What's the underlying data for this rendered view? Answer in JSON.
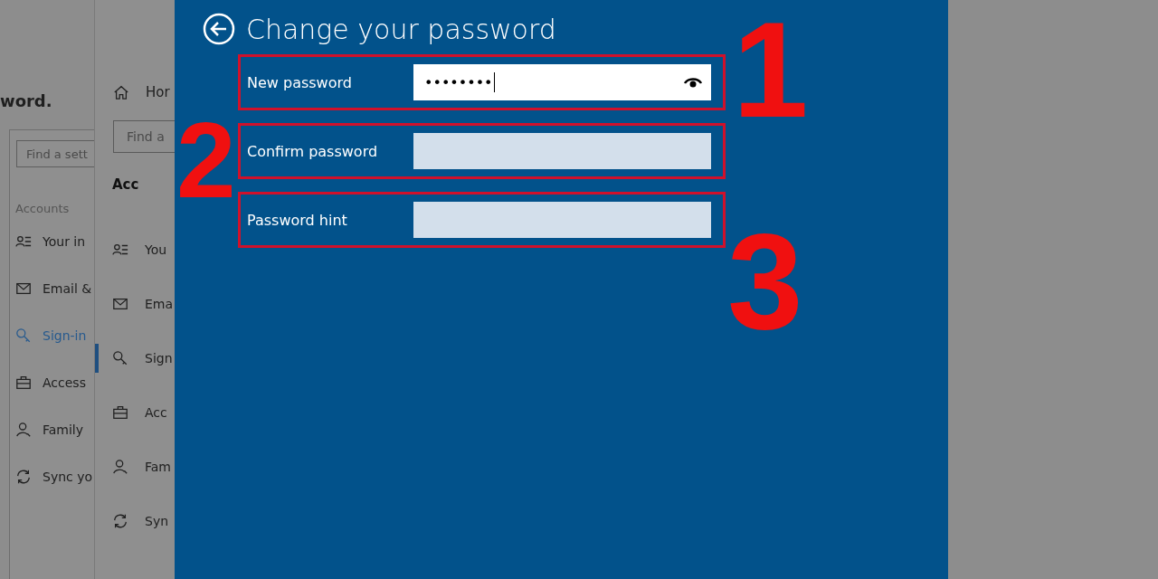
{
  "background_page": {
    "text": "word."
  },
  "back_window": {
    "search": {
      "placeholder": "Find a sett"
    },
    "section": "Accounts",
    "items": [
      {
        "label": "Your in",
        "kind": "info",
        "selected": false
      },
      {
        "label": "Email &",
        "kind": "email",
        "selected": false
      },
      {
        "label": "Sign-in",
        "kind": "signin",
        "selected": true
      },
      {
        "label": "Access",
        "kind": "access",
        "selected": false
      },
      {
        "label": "Family",
        "kind": "family",
        "selected": false
      },
      {
        "label": "Sync yo",
        "kind": "sync",
        "selected": false
      }
    ]
  },
  "settings_window": {
    "home": "Hor",
    "search": {
      "placeholder": "Find a"
    },
    "section": "Acc",
    "items": [
      {
        "label": "You",
        "kind": "info",
        "selected": false
      },
      {
        "label": "Ema",
        "kind": "email",
        "selected": false
      },
      {
        "label": "Sign",
        "kind": "signin",
        "selected": true
      },
      {
        "label": "Acc",
        "kind": "access",
        "selected": false
      },
      {
        "label": "Fam",
        "kind": "family",
        "selected": false
      },
      {
        "label": "Syn",
        "kind": "sync",
        "selected": false
      }
    ]
  },
  "dialog": {
    "title": "Change your password",
    "fields": [
      {
        "label": "New password",
        "value": "••••••••",
        "focused": true
      },
      {
        "label": "Confirm password",
        "focused": false
      },
      {
        "label": "Password hint",
        "focused": false
      }
    ]
  },
  "annotations": [
    {
      "text": "1",
      "kind": "one"
    },
    {
      "text": "2",
      "kind": "two"
    },
    {
      "text": "3",
      "kind": "three"
    }
  ]
}
